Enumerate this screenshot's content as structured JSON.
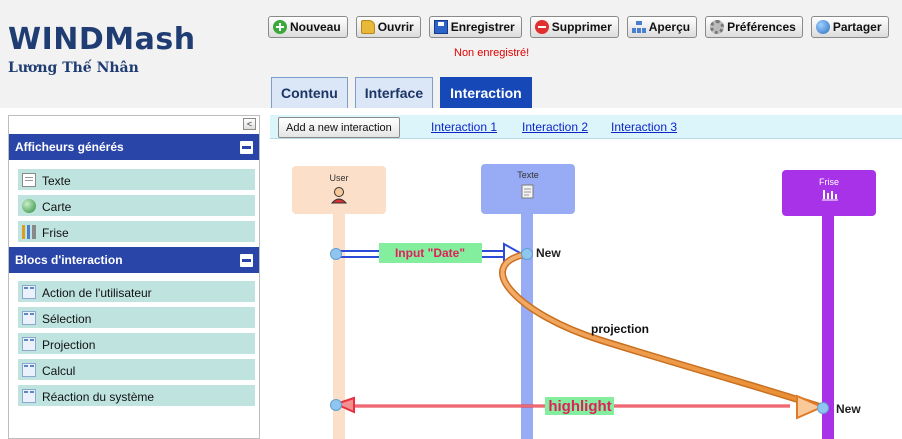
{
  "app": {
    "title": "WINDMash",
    "author": "Lương Thế Nhân"
  },
  "toolbar": {
    "buttons": [
      {
        "label": "Nouveau",
        "icon": "plus-icon"
      },
      {
        "label": "Ouvrir",
        "icon": "folder-icon"
      },
      {
        "label": "Enregistrer",
        "icon": "save-icon"
      },
      {
        "label": "Supprimer",
        "icon": "delete-icon"
      },
      {
        "label": "Aperçu",
        "icon": "preview-icon"
      },
      {
        "label": "Préférences",
        "icon": "gear-icon"
      },
      {
        "label": "Partager",
        "icon": "globe-icon"
      }
    ],
    "status": "Non enregistré!"
  },
  "tabs": {
    "items": [
      "Contenu",
      "Interface",
      "Interaction"
    ],
    "active": "Interaction"
  },
  "sidebar": {
    "collapse_glyph": "<",
    "sections": [
      {
        "title": "Afficheurs générés",
        "items": [
          "Texte",
          "Carte",
          "Frise"
        ]
      },
      {
        "title": "Blocs d'interaction",
        "items": [
          "Action de l'utilisateur",
          "Sélection",
          "Projection",
          "Calcul",
          "Réaction du système"
        ]
      }
    ]
  },
  "interaction_bar": {
    "add_label": "Add a new interaction",
    "links": [
      "Interaction 1",
      "Interaction 2",
      "Interaction 3"
    ]
  },
  "diagram": {
    "lifelines": [
      {
        "title": "User",
        "icon": "user-icon",
        "color": "#fbdfc9"
      },
      {
        "title": "Texte",
        "icon": "document-icon",
        "color": "#98acf5"
      },
      {
        "title": "Frise",
        "icon": "chart-icon",
        "color": "#a832e8"
      }
    ],
    "messages": [
      {
        "label": "Input \"Date\"",
        "from": "User",
        "to": "Texte",
        "target_label": "New"
      },
      {
        "label": "projection",
        "from": "Texte",
        "to": "Frise"
      },
      {
        "label": "highlight",
        "from": "Frise",
        "to": "User",
        "target_label": "New"
      }
    ]
  }
}
